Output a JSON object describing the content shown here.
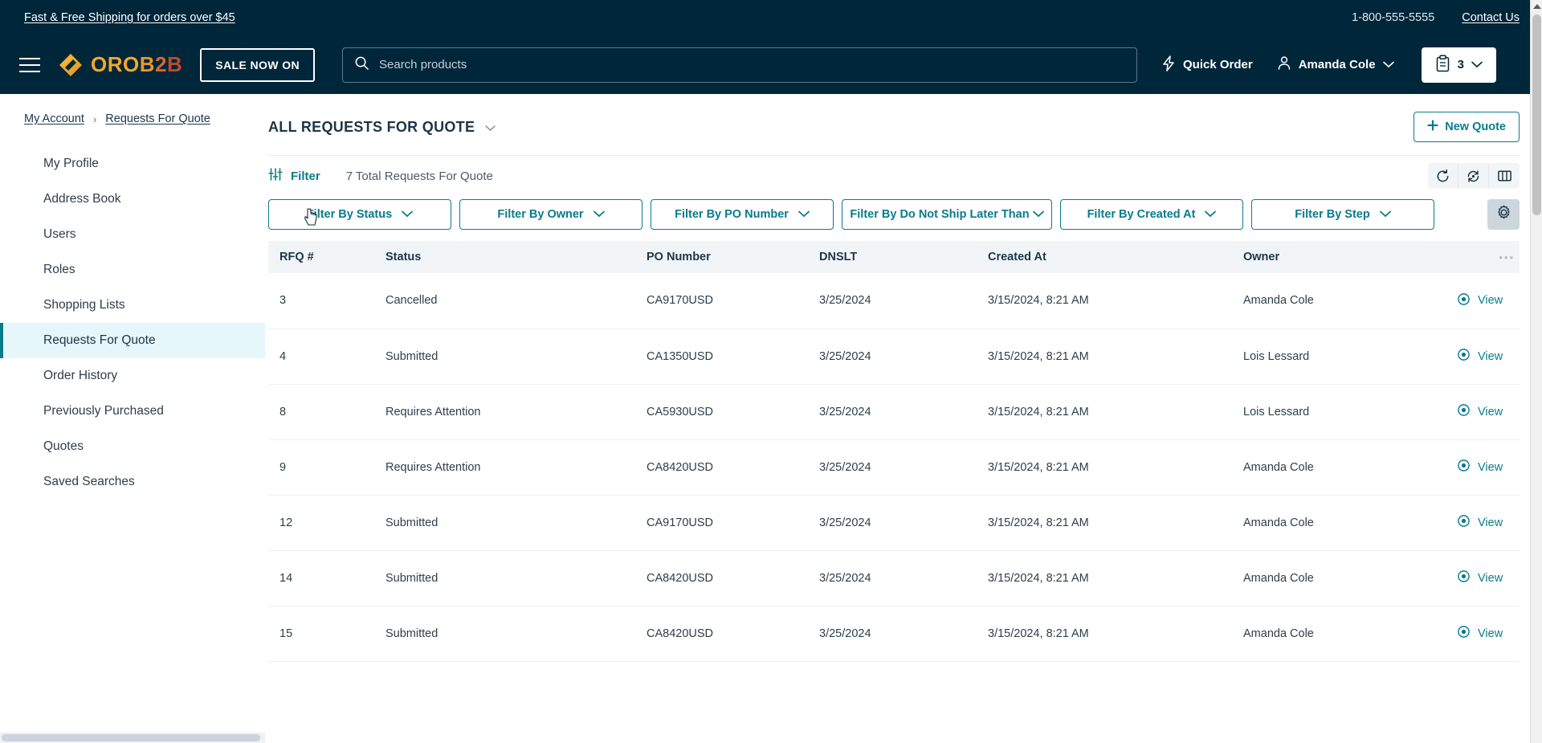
{
  "topbar": {
    "shipping_banner": "Fast & Free Shipping for orders over $45",
    "phone": "1-800-555-5555",
    "contact_label": "Contact Us"
  },
  "header": {
    "logo_oro": "ORO",
    "logo_b": "B",
    "logo_2": "2",
    "logo_b2": "B",
    "sale_label": "SALE NOW ON",
    "search_placeholder": "Search products",
    "search_value": "",
    "quick_order_label": "Quick Order",
    "account_name": "Amanda Cole",
    "cart_count": "3"
  },
  "breadcrumb": {
    "root": "My Account",
    "separator": "›",
    "current": "Requests For Quote"
  },
  "sidebar": {
    "items": [
      {
        "label": "My Profile",
        "active": false
      },
      {
        "label": "Address Book",
        "active": false
      },
      {
        "label": "Users",
        "active": false
      },
      {
        "label": "Roles",
        "active": false
      },
      {
        "label": "Shopping Lists",
        "active": false
      },
      {
        "label": "Requests For Quote",
        "active": true
      },
      {
        "label": "Order History",
        "active": false
      },
      {
        "label": "Previously Purchased",
        "active": false
      },
      {
        "label": "Quotes",
        "active": false
      },
      {
        "label": "Saved Searches",
        "active": false
      }
    ]
  },
  "main": {
    "title": "ALL REQUESTS FOR QUOTE",
    "new_quote_label": "New Quote",
    "filter_label": "Filter",
    "total_text": "7 Total Requests For Quote",
    "grid_tools": [
      {
        "name": "refresh-icon",
        "title": "Refresh"
      },
      {
        "name": "reset-icon",
        "title": "Reset"
      },
      {
        "name": "columns-icon",
        "title": "Columns"
      }
    ],
    "settings_icon": "gear-icon",
    "filters": [
      "Filter By Status",
      "Filter By Owner",
      "Filter By PO Number",
      "Filter By Do Not Ship Later Than",
      "Filter By Created At",
      "Filter By Step"
    ],
    "row_menu_dots": "•••",
    "view_label": "View"
  },
  "table": {
    "columns": [
      "RFQ #",
      "Status",
      "PO Number",
      "DNSLT",
      "Created At",
      "Owner"
    ],
    "rows": [
      {
        "rfq": "3",
        "status": "Cancelled",
        "po": "CA9170USD",
        "dnslt": "3/25/2024",
        "created": "3/15/2024, 8:21 AM",
        "owner": "Amanda Cole"
      },
      {
        "rfq": "4",
        "status": "Submitted",
        "po": "CA1350USD",
        "dnslt": "3/25/2024",
        "created": "3/15/2024, 8:21 AM",
        "owner": "Lois Lessard"
      },
      {
        "rfq": "8",
        "status": "Requires Attention",
        "po": "CA5930USD",
        "dnslt": "3/25/2024",
        "created": "3/15/2024, 8:21 AM",
        "owner": "Lois Lessard"
      },
      {
        "rfq": "9",
        "status": "Requires Attention",
        "po": "CA8420USD",
        "dnslt": "3/25/2024",
        "created": "3/15/2024, 8:21 AM",
        "owner": "Amanda Cole"
      },
      {
        "rfq": "12",
        "status": "Submitted",
        "po": "CA9170USD",
        "dnslt": "3/25/2024",
        "created": "3/15/2024, 8:21 AM",
        "owner": "Amanda Cole"
      },
      {
        "rfq": "14",
        "status": "Submitted",
        "po": "CA8420USD",
        "dnslt": "3/25/2024",
        "created": "3/15/2024, 8:21 AM",
        "owner": "Amanda Cole"
      },
      {
        "rfq": "15",
        "status": "Submitted",
        "po": "CA8420USD",
        "dnslt": "3/25/2024",
        "created": "3/15/2024, 8:21 AM",
        "owner": "Amanda Cole"
      }
    ]
  },
  "colors": {
    "header_bg": "#00263a",
    "accent_teal": "#0a7b8c",
    "active_nav_bg": "#e6f7fb",
    "logo_gold": "#f0a92a",
    "logo_red": "#bf4b2e"
  }
}
